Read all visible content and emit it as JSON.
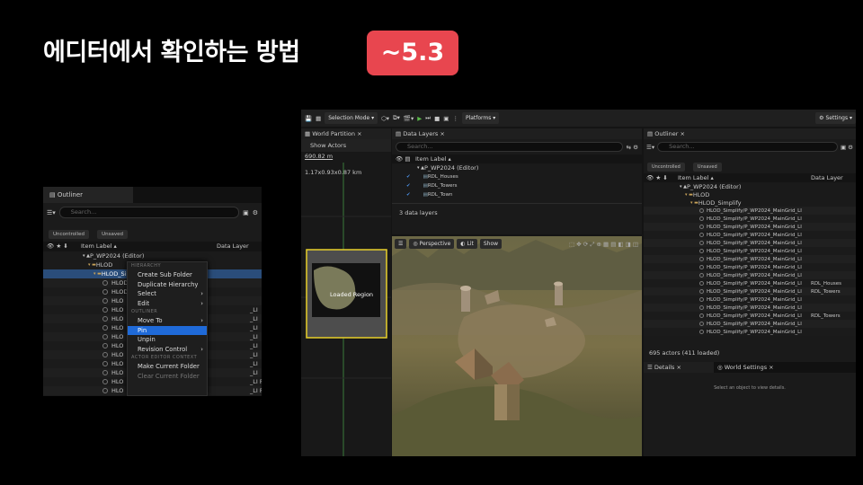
{
  "slide": {
    "title": "에디터에서 확인하는 방법",
    "version_badge": "~5.3"
  },
  "small_outliner": {
    "tab": "Outliner",
    "search_placeholder": "Search...",
    "filters": [
      "Uncontrolled",
      "Unsaved"
    ],
    "col_item": "Item Label ▴",
    "col_layer": "Data Layer",
    "tree": [
      {
        "label": "P_WP2024 (Editor)",
        "indent": 1
      },
      {
        "label": "HLOD",
        "indent": 2
      },
      {
        "label": "HLOD_Simplify",
        "indent": 3,
        "selected": true
      }
    ],
    "rows": [
      {
        "label": "HLOD",
        "layer": ""
      },
      {
        "label": "HLOD",
        "layer": ""
      },
      {
        "label": "HLO",
        "layer": ""
      },
      {
        "label": "HLO",
        "layer": "_LI"
      },
      {
        "label": "HLO",
        "layer": "_LI"
      },
      {
        "label": "HLO",
        "layer": "_LI"
      },
      {
        "label": "HLO",
        "layer": "_LI"
      },
      {
        "label": "HLO",
        "layer": "_LI"
      },
      {
        "label": "HLO",
        "layer": "_LI"
      },
      {
        "label": "HLO",
        "layer": "_LI"
      },
      {
        "label": "HLO",
        "layer": "_LI"
      },
      {
        "label": "HLO",
        "layer": "_LI RDL_Houses"
      },
      {
        "label": "HLO",
        "layer": "_LI RDL_Towers"
      },
      {
        "label": "HLO",
        "layer": "_LI"
      },
      {
        "label": "HLO",
        "layer": "_LI RDL_Houses"
      },
      {
        "label": "HLO",
        "layer": "_LI"
      },
      {
        "label": "HLO",
        "layer": "_LI RDL_Towers"
      }
    ]
  },
  "context_menu": {
    "sections": {
      "hierarchy": "HIERARCHY",
      "outliner": "OUTLINER",
      "actor_editor": "ACTOR EDITOR CONTEXT"
    },
    "items_hierarchy": [
      {
        "label": "Create Sub Folder"
      },
      {
        "label": "Duplicate Hierarchy"
      },
      {
        "label": "Select",
        "sub": "›"
      },
      {
        "label": "Edit",
        "sub": "›"
      }
    ],
    "items_outliner": [
      {
        "label": "Move To",
        "sub": "›"
      },
      {
        "label": "Pin",
        "hl": true
      },
      {
        "label": "Unpin"
      },
      {
        "label": "Revision Control",
        "sub": "›"
      }
    ],
    "items_actor": [
      {
        "label": "Make Current Folder"
      },
      {
        "label": "Clear Current Folder",
        "dis": true
      }
    ]
  },
  "editor": {
    "toolbar": {
      "selection_mode": "Selection Mode",
      "platforms": "Platforms",
      "settings": "Settings"
    },
    "world_partition": {
      "tab": "World Partition",
      "show_actors": "Show Actors",
      "scale": "690.82 m",
      "dims": "1.17x0.93x0.87 km",
      "region_label": "Loaded Region"
    },
    "data_layers": {
      "tab": "Data Layers",
      "search_placeholder": "Search...",
      "col": "Item Label ▴",
      "root": "P_WP2024 (Editor)",
      "layers": [
        "RDL_Houses",
        "RDL_Towers",
        "RDL_Town"
      ],
      "footer": "3 data layers"
    },
    "viewport": {
      "perspective": "Perspective",
      "lit": "Lit",
      "show": "Show"
    },
    "outliner": {
      "tab": "Outliner",
      "search_placeholder": "Search...",
      "filters": [
        "Uncontrolled",
        "Unsaved"
      ],
      "col_item": "Item Label ▴",
      "col_layer": "Data Layer",
      "root": "P_WP2024 (Editor)",
      "hlod": "HLOD",
      "simplify": "HLOD_Simplify",
      "rows": [
        {
          "label": "HLOD_Simplify/P_WP2024_MainGrid_LI",
          "layer": ""
        },
        {
          "label": "HLOD_Simplify/P_WP2024_MainGrid_LI",
          "layer": ""
        },
        {
          "label": "HLOD_Simplify/P_WP2024_MainGrid_LI",
          "layer": ""
        },
        {
          "label": "HLOD_Simplify/P_WP2024_MainGrid_LI",
          "layer": ""
        },
        {
          "label": "HLOD_Simplify/P_WP2024_MainGrid_LI",
          "layer": ""
        },
        {
          "label": "HLOD_Simplify/P_WP2024_MainGrid_LI",
          "layer": ""
        },
        {
          "label": "HLOD_Simplify/P_WP2024_MainGrid_LI",
          "layer": ""
        },
        {
          "label": "HLOD_Simplify/P_WP2024_MainGrid_LI",
          "layer": ""
        },
        {
          "label": "HLOD_Simplify/P_WP2024_MainGrid_LI",
          "layer": ""
        },
        {
          "label": "HLOD_Simplify/P_WP2024_MainGrid_LI",
          "layer": "RDL_Houses"
        },
        {
          "label": "HLOD_Simplify/P_WP2024_MainGrid_LI",
          "layer": "RDL_Towers"
        },
        {
          "label": "HLOD_Simplify/P_WP2024_MainGrid_LI",
          "layer": ""
        },
        {
          "label": "HLOD_Simplify/P_WP2024_MainGrid_LI",
          "layer": ""
        },
        {
          "label": "HLOD_Simplify/P_WP2024_MainGrid_LI",
          "layer": "RDL_Towers"
        },
        {
          "label": "HLOD_Simplify/P_WP2024_MainGrid_LI",
          "layer": ""
        },
        {
          "label": "HLOD_Simplify/P_WP2024_MainGrid_LI",
          "layer": ""
        }
      ],
      "footer": "695 actors (411 loaded)"
    },
    "details": {
      "tab1": "Details",
      "tab2": "World Settings",
      "empty": "Select an object to view details."
    }
  },
  "colors": {
    "badge": "#e8464f",
    "selection": "#2a4d7a",
    "menu_highlight": "#1f6ad8",
    "region_border": "#e8d02a",
    "play": "#5bb84a"
  }
}
